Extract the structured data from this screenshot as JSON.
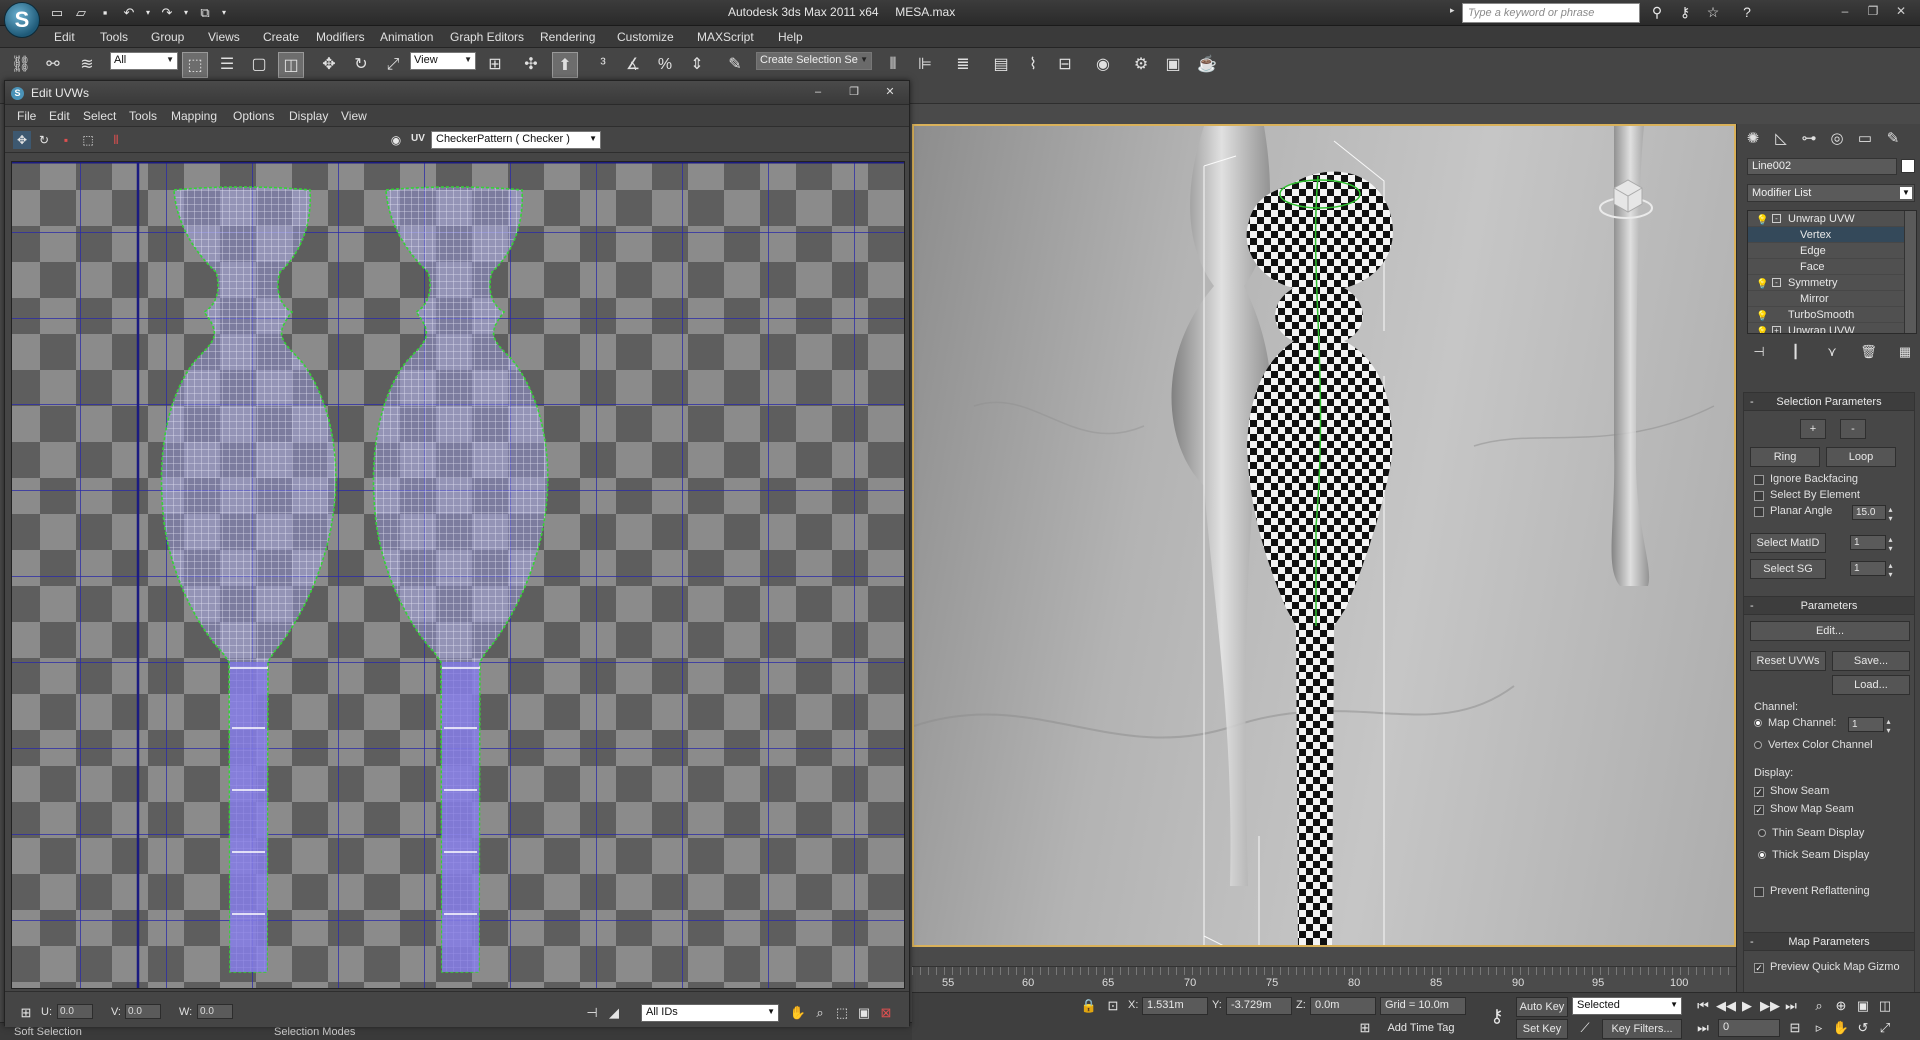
{
  "app": {
    "title": "Autodesk 3ds Max  2011 x64",
    "file": "MESA.max",
    "search_placeholder": "Type a keyword or phrase"
  },
  "menu": [
    "Edit",
    "Tools",
    "Group",
    "Views",
    "Create",
    "Modifiers",
    "Animation",
    "Graph Editors",
    "Rendering",
    "Customize",
    "MAXScript",
    "Help"
  ],
  "toolbar": {
    "selection_filter": "All",
    "reference_coord": "View",
    "named_selection": "Create Selection Se"
  },
  "uvw": {
    "title": "Edit UVWs",
    "menu": [
      "File",
      "Edit",
      "Select",
      "Tools",
      "Mapping",
      "Options",
      "Display",
      "View"
    ],
    "uv_label": "UV",
    "texture": "CheckerPattern  ( Checker )",
    "u_label": "U:",
    "v_label": "V:",
    "w_label": "W:",
    "u_value": "0.0",
    "v_value": "0.0",
    "w_value": "0.0",
    "ids": "All IDs"
  },
  "command_panel": {
    "object_name": "Line002",
    "modifier_list": "Modifier List",
    "stack": [
      {
        "label": "Unwrap UVW",
        "level": 0,
        "bulb": true,
        "box": "-"
      },
      {
        "label": "Vertex",
        "level": 1,
        "selected": true
      },
      {
        "label": "Edge",
        "level": 1
      },
      {
        "label": "Face",
        "level": 1
      },
      {
        "label": "Symmetry",
        "level": 0,
        "bulb": true,
        "box": "+"
      },
      {
        "label": "Mirror",
        "level": 1
      },
      {
        "label": "TurboSmooth",
        "level": 0,
        "bulb": true
      },
      {
        "label": "Unwrap UVW",
        "level": 0,
        "bulb": true,
        "box": "+"
      }
    ],
    "selection_parameters": {
      "title": "Selection Parameters",
      "plus": "+",
      "minus": "-",
      "ring": "Ring",
      "loop": "Loop",
      "ignore_backfacing": "Ignore Backfacing",
      "select_by_element": "Select By Element",
      "planar_angle": "Planar Angle",
      "planar_angle_value": "15.0",
      "select_matid": "Select MatID",
      "matid_value": "1",
      "select_sg": "Select SG",
      "sg_value": "1"
    },
    "parameters": {
      "title": "Parameters",
      "edit": "Edit...",
      "reset_uvws": "Reset UVWs",
      "save": "Save...",
      "load": "Load...",
      "channel_label": "Channel:",
      "map_channel": "Map Channel:",
      "map_channel_value": "1",
      "vertex_color_channel": "Vertex Color Channel",
      "display_label": "Display:",
      "show_seam": "Show Seam",
      "show_map_seam": "Show Map Seam",
      "thin_seam": "Thin Seam Display",
      "thick_seam": "Thick Seam Display",
      "prevent_reflattening": "Prevent Reflattening"
    },
    "map_parameters": {
      "title": "Map Parameters",
      "preview_gizmo": "Preview Quick Map Gizmo"
    }
  },
  "timeline": [
    "55",
    "60",
    "65",
    "70",
    "75",
    "80",
    "85",
    "90",
    "95",
    "100"
  ],
  "status": {
    "x_label": "X:",
    "x_value": "1.531m",
    "y_label": "Y:",
    "y_value": "-3.729m",
    "z_label": "Z:",
    "z_value": "0.0m",
    "grid": "Grid = 10.0m",
    "add_time_tag": "Add Time Tag",
    "auto_key": "Auto Key",
    "set_key": "Set Key",
    "key_mode": "Selected",
    "key_filters": "Key Filters...",
    "frame": "0",
    "left_status_1": "Soft Selection",
    "left_status_2": "Selection Modes"
  }
}
